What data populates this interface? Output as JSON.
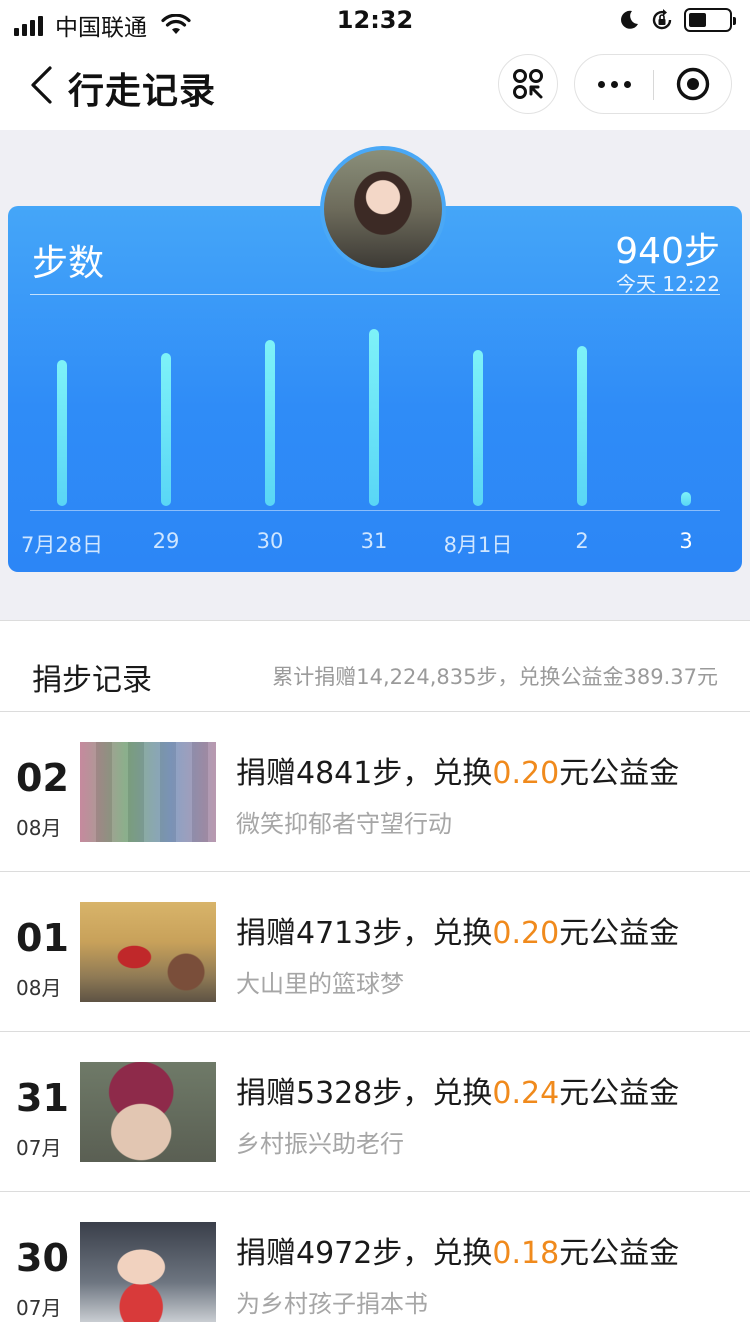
{
  "status_bar": {
    "carrier": "中国联通",
    "time": "12:32",
    "battery_level": 0.45
  },
  "nav": {
    "title": "行走记录"
  },
  "steps_card": {
    "label": "步数",
    "count": "940步",
    "updated": "今天 12:22"
  },
  "chart_data": {
    "type": "bar",
    "title": "",
    "categories": [
      "7月28日",
      "29",
      "30",
      "31",
      "8月1日",
      "2",
      "3"
    ],
    "values": [
      10200,
      10700,
      11600,
      12400,
      10900,
      11200,
      940
    ],
    "active_index": 6,
    "ylim": [
      0,
      13000
    ],
    "grid": false,
    "legend": "none",
    "bar_color": "#66e0f7"
  },
  "records": {
    "title": "捐步记录",
    "summary": "累计捐赠14,224,835步，兑换公益金389.37元",
    "currency_color": "#f08a1c",
    "items": [
      {
        "day": "02",
        "month": "08月",
        "prefix": "捐赠4841步，兑换",
        "amount": "0.20",
        "suffix": "元公益金",
        "project": "微笑抑郁者守望行动"
      },
      {
        "day": "01",
        "month": "08月",
        "prefix": "捐赠4713步，兑换",
        "amount": "0.20",
        "suffix": "元公益金",
        "project": "大山里的篮球梦"
      },
      {
        "day": "31",
        "month": "07月",
        "prefix": "捐赠5328步，兑换",
        "amount": "0.24",
        "suffix": "元公益金",
        "project": "乡村振兴助老行"
      },
      {
        "day": "30",
        "month": "07月",
        "prefix": "捐赠4972步，兑换",
        "amount": "0.18",
        "suffix": "元公益金",
        "project": "为乡村孩子捐本书"
      }
    ]
  }
}
